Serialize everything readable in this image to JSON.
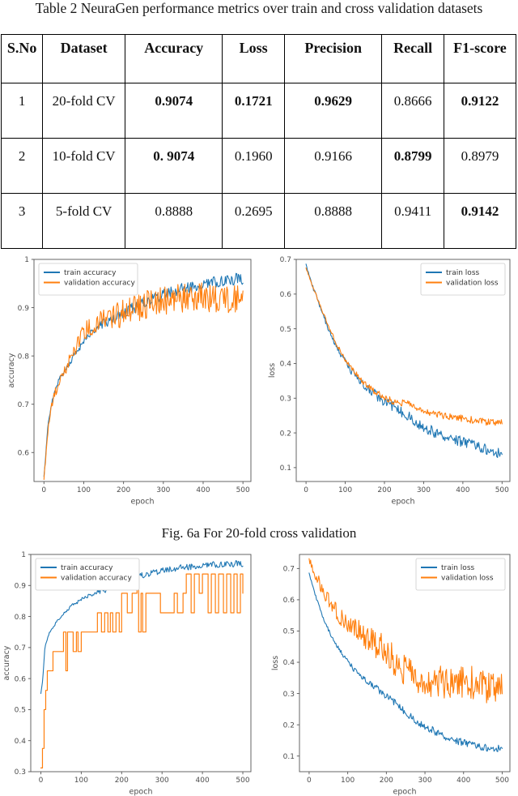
{
  "document": {
    "table": {
      "caption": "Table 2 NeuraGen performance metrics over train and cross validation datasets",
      "columns": [
        "S.No",
        "Dataset",
        "Accuracy",
        "Loss",
        "Precision",
        "Recall",
        "F1-score"
      ],
      "rows": [
        {
          "sno": "1",
          "dataset": "20-fold CV",
          "accuracy": "0.9074",
          "loss": "0.1721",
          "precision": "0.9629",
          "recall": "0.8666",
          "f1": "0.9122",
          "bold": {
            "accuracy": true,
            "loss": true,
            "precision": true,
            "recall": false,
            "f1": true
          }
        },
        {
          "sno": "2",
          "dataset": "10-fold CV",
          "accuracy": "0. 9074",
          "loss": "0.1960",
          "precision": "0.9166",
          "recall": "0.8799",
          "f1": "0.8979",
          "bold": {
            "accuracy": true,
            "loss": false,
            "precision": false,
            "recall": true,
            "f1": false
          }
        },
        {
          "sno": "3",
          "dataset": "5-fold CV",
          "accuracy": "0.8888",
          "loss": "0.2695",
          "precision": "0.8888",
          "recall": "0.9411",
          "f1": "0.9142",
          "bold": {
            "accuracy": false,
            "loss": false,
            "precision": false,
            "recall": false,
            "f1": true
          }
        }
      ]
    },
    "figure_caption_6a": "Fig. 6a For 20-fold cross validation"
  },
  "colors": {
    "train": "#1f77b4",
    "validation": "#ff7f0e",
    "axis": "#555555",
    "text": "#4d4d4d"
  },
  "chart_data": [
    {
      "id": "fig6a-accuracy",
      "type": "line",
      "title": "",
      "xlabel": "epoch",
      "ylabel": "accuracy",
      "xlim": [
        -25,
        520
      ],
      "ylim": [
        0.54,
        1.0
      ],
      "xticks": [
        0,
        100,
        200,
        300,
        400,
        500
      ],
      "yticks": [
        0.6,
        0.7,
        0.8,
        0.9,
        1.0
      ],
      "grid": false,
      "legend_position": "upper left",
      "series": [
        {
          "name": "train accuracy",
          "color": "#1f77b4",
          "noise": 0.012,
          "x": [
            0,
            5,
            10,
            20,
            30,
            40,
            50,
            60,
            70,
            80,
            90,
            100,
            120,
            140,
            160,
            180,
            200,
            220,
            240,
            260,
            280,
            300,
            320,
            340,
            360,
            380,
            400,
            420,
            440,
            460,
            480,
            500
          ],
          "y": [
            0.548,
            0.6,
            0.655,
            0.705,
            0.735,
            0.755,
            0.768,
            0.78,
            0.792,
            0.805,
            0.818,
            0.83,
            0.85,
            0.862,
            0.872,
            0.88,
            0.888,
            0.898,
            0.906,
            0.914,
            0.921,
            0.928,
            0.933,
            0.937,
            0.941,
            0.945,
            0.949,
            0.952,
            0.955,
            0.957,
            0.959,
            0.96
          ]
        },
        {
          "name": "validation accuracy",
          "color": "#ff7f0e",
          "noise": 0.03,
          "x": [
            0,
            5,
            10,
            20,
            30,
            40,
            50,
            60,
            70,
            80,
            90,
            100,
            120,
            140,
            160,
            180,
            200,
            220,
            240,
            260,
            280,
            300,
            320,
            340,
            360,
            380,
            400,
            420,
            440,
            460,
            480,
            500
          ],
          "y": [
            0.545,
            0.598,
            0.65,
            0.7,
            0.728,
            0.748,
            0.765,
            0.782,
            0.8,
            0.818,
            0.835,
            0.848,
            0.862,
            0.87,
            0.876,
            0.882,
            0.888,
            0.895,
            0.9,
            0.906,
            0.911,
            0.915,
            0.918,
            0.92,
            0.921,
            0.922,
            0.922,
            0.921,
            0.92,
            0.919,
            0.918,
            0.916
          ]
        }
      ]
    },
    {
      "id": "fig6a-loss",
      "type": "line",
      "title": "",
      "xlabel": "epoch",
      "ylabel": "loss",
      "xlim": [
        -25,
        520
      ],
      "ylim": [
        0.06,
        0.7
      ],
      "xticks": [
        0,
        100,
        200,
        300,
        400,
        500
      ],
      "yticks": [
        0.1,
        0.2,
        0.3,
        0.4,
        0.5,
        0.6,
        0.7
      ],
      "grid": false,
      "legend_position": "upper right",
      "series": [
        {
          "name": "train loss",
          "color": "#1f77b4",
          "noise": 0.016,
          "x": [
            0,
            10,
            20,
            30,
            40,
            50,
            60,
            80,
            100,
            120,
            140,
            160,
            180,
            200,
            220,
            240,
            260,
            280,
            300,
            320,
            340,
            360,
            380,
            400,
            420,
            440,
            460,
            480,
            500
          ],
          "y": [
            0.683,
            0.645,
            0.612,
            0.583,
            0.552,
            0.52,
            0.492,
            0.445,
            0.405,
            0.372,
            0.345,
            0.325,
            0.308,
            0.292,
            0.276,
            0.262,
            0.248,
            0.232,
            0.218,
            0.205,
            0.196,
            0.19,
            0.182,
            0.172,
            0.168,
            0.16,
            0.152,
            0.146,
            0.14
          ]
        },
        {
          "name": "validation loss",
          "color": "#ff7f0e",
          "noise": 0.01,
          "x": [
            0,
            10,
            20,
            30,
            40,
            50,
            60,
            80,
            100,
            120,
            140,
            160,
            180,
            200,
            220,
            240,
            260,
            280,
            300,
            320,
            340,
            360,
            380,
            400,
            420,
            440,
            460,
            480,
            500
          ],
          "y": [
            0.676,
            0.645,
            0.614,
            0.585,
            0.556,
            0.527,
            0.499,
            0.452,
            0.412,
            0.38,
            0.353,
            0.332,
            0.315,
            0.302,
            0.292,
            0.288,
            0.283,
            0.275,
            0.266,
            0.258,
            0.252,
            0.248,
            0.245,
            0.242,
            0.238,
            0.234,
            0.231,
            0.23,
            0.232
          ]
        }
      ]
    },
    {
      "id": "fig6b-accuracy",
      "type": "line",
      "title": "",
      "xlabel": "epoch",
      "ylabel": "accuracy",
      "xlim": [
        -25,
        520
      ],
      "ylim": [
        0.3,
        1.0
      ],
      "xticks": [
        0,
        100,
        200,
        300,
        400,
        500
      ],
      "yticks": [
        0.3,
        0.4,
        0.5,
        0.6,
        0.7,
        0.8,
        0.9,
        1.0
      ],
      "grid": false,
      "legend_position": "upper left",
      "series": [
        {
          "name": "train accuracy",
          "color": "#1f77b4",
          "noise": 0.01,
          "x": [
            0,
            5,
            10,
            20,
            30,
            40,
            50,
            60,
            80,
            100,
            120,
            140,
            160,
            180,
            200,
            220,
            240,
            260,
            280,
            300,
            320,
            340,
            360,
            380,
            400,
            420,
            440,
            460,
            480,
            500
          ],
          "y": [
            0.55,
            0.6,
            0.7,
            0.745,
            0.765,
            0.785,
            0.8,
            0.815,
            0.838,
            0.855,
            0.868,
            0.878,
            0.886,
            0.896,
            0.908,
            0.918,
            0.928,
            0.936,
            0.943,
            0.948,
            0.952,
            0.956,
            0.959,
            0.962,
            0.965,
            0.967,
            0.968,
            0.969,
            0.97,
            0.97
          ]
        },
        {
          "name": "validation accuracy",
          "color": "#ff7f0e",
          "step": true,
          "noise": 0.0,
          "x": [
            0,
            4,
            8,
            12,
            16,
            30,
            52,
            56,
            62,
            66,
            80,
            88,
            92,
            100,
            130,
            140,
            150,
            158,
            166,
            172,
            178,
            186,
            194,
            200,
            214,
            226,
            238,
            242,
            248,
            252,
            260,
            290,
            296,
            330,
            338,
            352,
            360,
            372,
            380,
            392,
            400,
            414,
            422,
            432,
            440,
            452,
            460,
            470,
            478,
            486,
            494,
            500
          ],
          "y": [
            0.312,
            0.375,
            0.5,
            0.562,
            0.625,
            0.687,
            0.687,
            0.75,
            0.625,
            0.75,
            0.687,
            0.75,
            0.687,
            0.75,
            0.75,
            0.812,
            0.75,
            0.812,
            0.75,
            0.812,
            0.75,
            0.812,
            0.75,
            0.875,
            0.812,
            0.875,
            0.937,
            0.75,
            0.875,
            0.75,
            0.875,
            0.875,
            0.812,
            0.875,
            0.812,
            0.875,
            0.937,
            0.812,
            0.937,
            0.875,
            0.937,
            0.812,
            0.937,
            0.812,
            0.937,
            0.812,
            0.937,
            0.812,
            0.937,
            0.812,
            0.937,
            0.875
          ]
        }
      ]
    },
    {
      "id": "fig6b-loss",
      "type": "line",
      "title": "",
      "xlabel": "epoch",
      "ylabel": "loss",
      "xlim": [
        -25,
        520
      ],
      "ylim": [
        0.05,
        0.745
      ],
      "xticks": [
        0,
        100,
        200,
        300,
        400,
        500
      ],
      "yticks": [
        0.1,
        0.2,
        0.3,
        0.4,
        0.5,
        0.6,
        0.7
      ],
      "grid": false,
      "legend_position": "upper right",
      "series": [
        {
          "name": "train loss",
          "color": "#1f77b4",
          "noise": 0.012,
          "x": [
            0,
            10,
            20,
            40,
            60,
            80,
            100,
            120,
            140,
            160,
            180,
            200,
            220,
            240,
            260,
            280,
            300,
            320,
            340,
            360,
            380,
            400,
            420,
            440,
            460,
            480,
            500
          ],
          "y": [
            0.683,
            0.64,
            0.6,
            0.53,
            0.478,
            0.438,
            0.402,
            0.372,
            0.348,
            0.33,
            0.312,
            0.294,
            0.272,
            0.25,
            0.228,
            0.21,
            0.196,
            0.182,
            0.17,
            0.158,
            0.15,
            0.142,
            0.136,
            0.13,
            0.126,
            0.124,
            0.126
          ]
        },
        {
          "name": "validation loss",
          "color": "#ff7f0e",
          "noise": 0.052,
          "x": [
            0,
            10,
            20,
            40,
            60,
            80,
            100,
            120,
            140,
            160,
            180,
            200,
            220,
            240,
            260,
            280,
            300,
            320,
            340,
            360,
            380,
            400,
            420,
            440,
            460,
            480,
            500
          ],
          "y": [
            0.735,
            0.7,
            0.672,
            0.618,
            0.578,
            0.548,
            0.53,
            0.505,
            0.485,
            0.468,
            0.452,
            0.432,
            0.408,
            0.382,
            0.362,
            0.35,
            0.344,
            0.34,
            0.336,
            0.334,
            0.336,
            0.34,
            0.336,
            0.326,
            0.316,
            0.318,
            0.33
          ]
        }
      ]
    }
  ]
}
